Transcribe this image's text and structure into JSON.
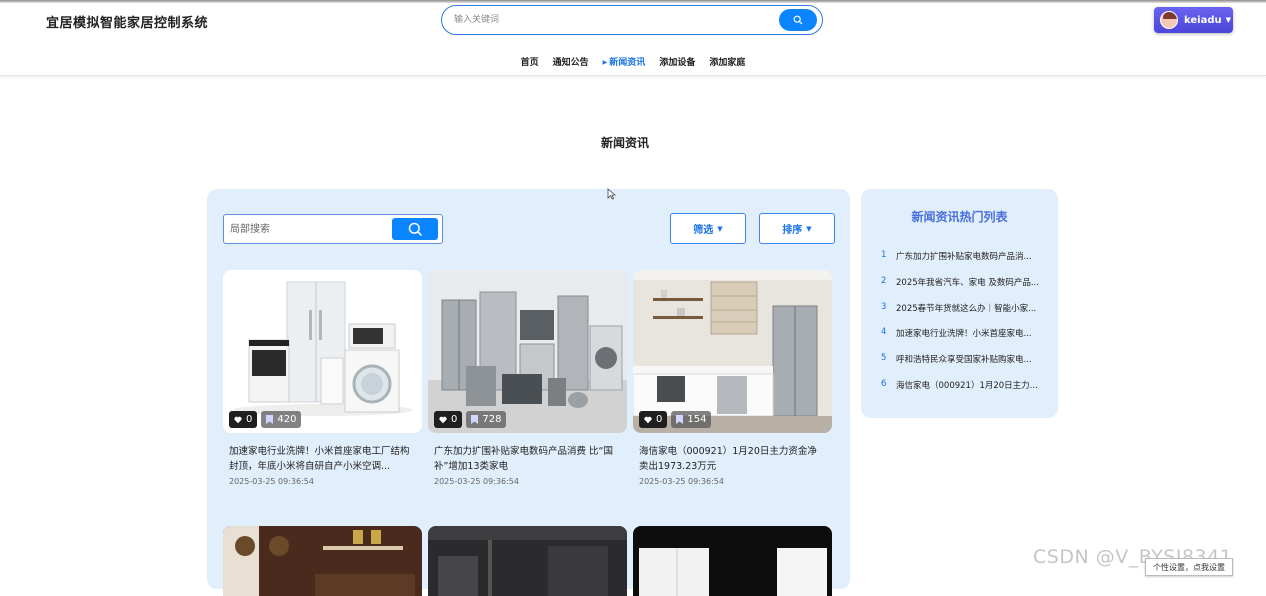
{
  "header": {
    "site_title": "宜居模拟智能家居控制系统",
    "search_placeholder": "输入关键词",
    "user": {
      "name": "keiadu"
    }
  },
  "nav": [
    "首页",
    "通知公告",
    "新闻资讯",
    "添加设备",
    "添加家庭"
  ],
  "nav_active_index": 2,
  "page_heading": "新闻资讯",
  "toolbar": {
    "local_search_placeholder": "局部搜索",
    "filter_label": "筛选",
    "sort_label": "排序"
  },
  "news": [
    {
      "title": "加速家电行业洗牌！小米首座家电工厂结构封顶，年底小米将自研自产小米空调...",
      "date": "2025-03-25 09:36:54",
      "likes": "0",
      "favorites": "420",
      "image": "appliances-white"
    },
    {
      "title": "广东加力扩围补贴家电数码产品消费 比“国补”增加13类家电",
      "date": "2025-03-25 09:36:54",
      "likes": "0",
      "favorites": "728",
      "image": "appliances-silver"
    },
    {
      "title": "海信家电（000921）1月20日主力资金净卖出1973.23万元",
      "date": "2025-03-25 09:36:54",
      "likes": "0",
      "favorites": "154",
      "image": "kitchen"
    }
  ],
  "hot_list": {
    "title": "新闻资讯热门列表",
    "items": [
      "广东加力扩围补贴家电数码产品消...",
      "2025年我省汽车、家电 及数码产品...",
      "2025春节年货就这么办｜智能小家...",
      "加速家电行业洗牌！小米首座家电...",
      "呼和浩特民众享受国家补贴购家电...",
      "海信家电（000921）1月20日主力..."
    ]
  },
  "watermark": "CSDN @V_BYSJ8341",
  "tooltip": "个性设置，点我设置",
  "colors": {
    "accent": "#0a84ff",
    "panel": "#e1eefb",
    "user_button": "#5a54e6"
  }
}
